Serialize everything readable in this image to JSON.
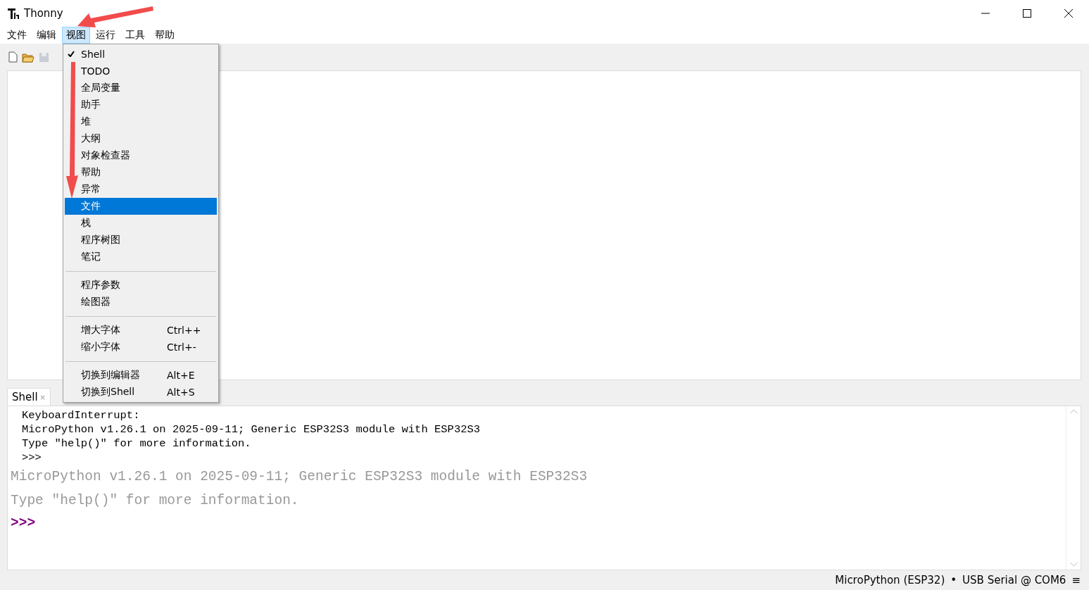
{
  "window": {
    "title": "Thonny"
  },
  "menubar": [
    {
      "label": "文件",
      "selected": false
    },
    {
      "label": "编辑",
      "selected": false
    },
    {
      "label": "视图",
      "selected": true
    },
    {
      "label": "运行",
      "selected": false
    },
    {
      "label": "工具",
      "selected": false
    },
    {
      "label": "帮助",
      "selected": false
    }
  ],
  "view_menu": [
    {
      "kind": "item",
      "label": "Shell",
      "checked": true,
      "selected": false
    },
    {
      "kind": "item",
      "label": "TODO",
      "checked": false,
      "selected": false
    },
    {
      "kind": "item",
      "label": "全局变量",
      "checked": false,
      "selected": false
    },
    {
      "kind": "item",
      "label": "助手",
      "checked": false,
      "selected": false
    },
    {
      "kind": "item",
      "label": "堆",
      "checked": false,
      "selected": false
    },
    {
      "kind": "item",
      "label": "大纲",
      "checked": false,
      "selected": false
    },
    {
      "kind": "item",
      "label": "对象检查器",
      "checked": false,
      "selected": false
    },
    {
      "kind": "item",
      "label": "帮助",
      "checked": false,
      "selected": false
    },
    {
      "kind": "item",
      "label": "异常",
      "checked": false,
      "selected": false
    },
    {
      "kind": "item",
      "label": "文件",
      "checked": false,
      "selected": true
    },
    {
      "kind": "item",
      "label": "栈",
      "checked": false,
      "selected": false
    },
    {
      "kind": "item",
      "label": "程序树图",
      "checked": false,
      "selected": false
    },
    {
      "kind": "item",
      "label": "笔记",
      "checked": false,
      "selected": false
    },
    {
      "kind": "separator"
    },
    {
      "kind": "item",
      "label": "程序参数",
      "checked": false,
      "selected": false
    },
    {
      "kind": "item",
      "label": "绘图器",
      "checked": false,
      "selected": false
    },
    {
      "kind": "separator"
    },
    {
      "kind": "item",
      "label": "增大字体",
      "shortcut": "Ctrl++",
      "checked": false,
      "selected": false
    },
    {
      "kind": "item",
      "label": "缩小字体",
      "shortcut": "Ctrl+-",
      "checked": false,
      "selected": false
    },
    {
      "kind": "separator"
    },
    {
      "kind": "item",
      "label": "切换到编辑器",
      "shortcut": "Alt+E",
      "checked": false,
      "selected": false
    },
    {
      "kind": "item",
      "label": "切换到Shell",
      "shortcut": "Alt+S",
      "checked": false,
      "selected": false
    }
  ],
  "shell": {
    "tab": {
      "label": "Shell",
      "close": "×",
      "selected": true
    },
    "lines": [
      {
        "kind": "output",
        "text": "KeyboardInterrupt:"
      },
      {
        "kind": "output",
        "text": "MicroPython v1.26.1 on 2025-09-11; Generic ESP32S3 module with ESP32S3"
      },
      {
        "kind": "output",
        "text": "Type \"help()\" for more information."
      },
      {
        "kind": "output",
        "text": ">>>"
      },
      {
        "kind": "banner",
        "text": "MicroPython v1.26.1 on 2025-09-11; Generic ESP32S3 module with ESP32S3"
      },
      {
        "kind": "banner",
        "text": "Type \"help()\" for more information."
      },
      {
        "kind": "prompt",
        "text": ">>>"
      }
    ]
  },
  "status_bar": {
    "interpreter": "MicroPython (ESP32)",
    "separator": "•",
    "port": "USB Serial @ COM6",
    "menu": "≡"
  }
}
